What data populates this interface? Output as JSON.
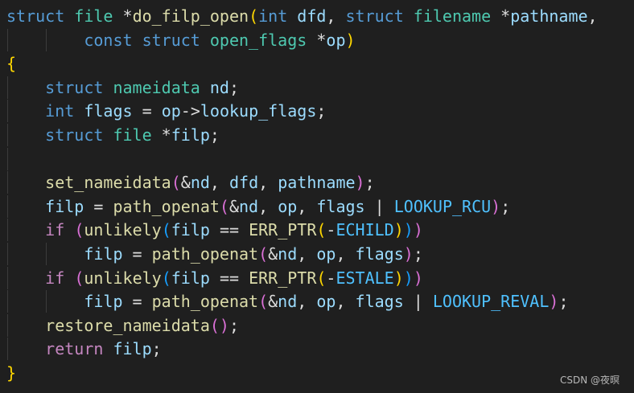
{
  "editor": {
    "colors": {
      "background": "#1f1f1f",
      "keyword": "#569cd6",
      "control_keyword": "#c586c0",
      "type": "#4ec9b0",
      "function": "#dcdcaa",
      "variable": "#9cdcfe",
      "macro": "#4fc1ff",
      "bracket_level1": "#ffd700",
      "bracket_level2": "#da70d6",
      "bracket_level3": "#179fff",
      "plain": "#dcdcdc"
    },
    "lines": [
      [
        {
          "t": "struct",
          "c": "kw"
        },
        {
          "t": " ",
          "c": "pl"
        },
        {
          "t": "file",
          "c": "ty"
        },
        {
          "t": " *",
          "c": "pl"
        },
        {
          "t": "do_filp_open",
          "c": "fn"
        },
        {
          "t": "(",
          "c": "br-y"
        },
        {
          "t": "int",
          "c": "kw"
        },
        {
          "t": " ",
          "c": "pl"
        },
        {
          "t": "dfd",
          "c": "vr"
        },
        {
          "t": ", ",
          "c": "pl"
        },
        {
          "t": "struct",
          "c": "kw"
        },
        {
          "t": " ",
          "c": "pl"
        },
        {
          "t": "filename",
          "c": "ty"
        },
        {
          "t": " *",
          "c": "pl"
        },
        {
          "t": "pathname",
          "c": "vr"
        },
        {
          "t": ",",
          "c": "pl"
        }
      ],
      [
        {
          "t": "        ",
          "c": "pl"
        },
        {
          "t": "const",
          "c": "kw"
        },
        {
          "t": " ",
          "c": "pl"
        },
        {
          "t": "struct",
          "c": "kw"
        },
        {
          "t": " ",
          "c": "pl"
        },
        {
          "t": "open_flags",
          "c": "ty"
        },
        {
          "t": " *",
          "c": "pl"
        },
        {
          "t": "op",
          "c": "vr"
        },
        {
          "t": ")",
          "c": "br-y"
        }
      ],
      [
        {
          "t": "{",
          "c": "br-y"
        }
      ],
      [
        {
          "t": "    ",
          "c": "pl"
        },
        {
          "t": "struct",
          "c": "kw"
        },
        {
          "t": " ",
          "c": "pl"
        },
        {
          "t": "nameidata",
          "c": "ty"
        },
        {
          "t": " ",
          "c": "pl"
        },
        {
          "t": "nd",
          "c": "vr"
        },
        {
          "t": ";",
          "c": "pl"
        }
      ],
      [
        {
          "t": "    ",
          "c": "pl"
        },
        {
          "t": "int",
          "c": "kw"
        },
        {
          "t": " ",
          "c": "pl"
        },
        {
          "t": "flags",
          "c": "vr"
        },
        {
          "t": " = ",
          "c": "pl"
        },
        {
          "t": "op",
          "c": "vr"
        },
        {
          "t": "->",
          "c": "pl"
        },
        {
          "t": "lookup_flags",
          "c": "vr"
        },
        {
          "t": ";",
          "c": "pl"
        }
      ],
      [
        {
          "t": "    ",
          "c": "pl"
        },
        {
          "t": "struct",
          "c": "kw"
        },
        {
          "t": " ",
          "c": "pl"
        },
        {
          "t": "file",
          "c": "ty"
        },
        {
          "t": " *",
          "c": "pl"
        },
        {
          "t": "filp",
          "c": "vr"
        },
        {
          "t": ";",
          "c": "pl"
        }
      ],
      [],
      [
        {
          "t": "    ",
          "c": "pl"
        },
        {
          "t": "set_nameidata",
          "c": "fn"
        },
        {
          "t": "(",
          "c": "br-p"
        },
        {
          "t": "&",
          "c": "pl"
        },
        {
          "t": "nd",
          "c": "vr"
        },
        {
          "t": ", ",
          "c": "pl"
        },
        {
          "t": "dfd",
          "c": "vr"
        },
        {
          "t": ", ",
          "c": "pl"
        },
        {
          "t": "pathname",
          "c": "vr"
        },
        {
          "t": ")",
          "c": "br-p"
        },
        {
          "t": ";",
          "c": "pl"
        }
      ],
      [
        {
          "t": "    ",
          "c": "pl"
        },
        {
          "t": "filp",
          "c": "vr"
        },
        {
          "t": " = ",
          "c": "pl"
        },
        {
          "t": "path_openat",
          "c": "fn"
        },
        {
          "t": "(",
          "c": "br-p"
        },
        {
          "t": "&",
          "c": "pl"
        },
        {
          "t": "nd",
          "c": "vr"
        },
        {
          "t": ", ",
          "c": "pl"
        },
        {
          "t": "op",
          "c": "vr"
        },
        {
          "t": ", ",
          "c": "pl"
        },
        {
          "t": "flags",
          "c": "vr"
        },
        {
          "t": " | ",
          "c": "pl"
        },
        {
          "t": "LOOKUP_RCU",
          "c": "mc"
        },
        {
          "t": ")",
          "c": "br-p"
        },
        {
          "t": ";",
          "c": "pl"
        }
      ],
      [
        {
          "t": "    ",
          "c": "pl"
        },
        {
          "t": "if",
          "c": "kc"
        },
        {
          "t": " ",
          "c": "pl"
        },
        {
          "t": "(",
          "c": "br-p"
        },
        {
          "t": "unlikely",
          "c": "fn"
        },
        {
          "t": "(",
          "c": "br-b"
        },
        {
          "t": "filp",
          "c": "vr"
        },
        {
          "t": " == ",
          "c": "pl"
        },
        {
          "t": "ERR_PTR",
          "c": "fn"
        },
        {
          "t": "(",
          "c": "br-y"
        },
        {
          "t": "-",
          "c": "pl"
        },
        {
          "t": "ECHILD",
          "c": "mc"
        },
        {
          "t": ")",
          "c": "br-y"
        },
        {
          "t": ")",
          "c": "br-b"
        },
        {
          "t": ")",
          "c": "br-p"
        }
      ],
      [
        {
          "t": "        ",
          "c": "pl"
        },
        {
          "t": "filp",
          "c": "vr"
        },
        {
          "t": " = ",
          "c": "pl"
        },
        {
          "t": "path_openat",
          "c": "fn"
        },
        {
          "t": "(",
          "c": "br-p"
        },
        {
          "t": "&",
          "c": "pl"
        },
        {
          "t": "nd",
          "c": "vr"
        },
        {
          "t": ", ",
          "c": "pl"
        },
        {
          "t": "op",
          "c": "vr"
        },
        {
          "t": ", ",
          "c": "pl"
        },
        {
          "t": "flags",
          "c": "vr"
        },
        {
          "t": ")",
          "c": "br-p"
        },
        {
          "t": ";",
          "c": "pl"
        }
      ],
      [
        {
          "t": "    ",
          "c": "pl"
        },
        {
          "t": "if",
          "c": "kc"
        },
        {
          "t": " ",
          "c": "pl"
        },
        {
          "t": "(",
          "c": "br-p"
        },
        {
          "t": "unlikely",
          "c": "fn"
        },
        {
          "t": "(",
          "c": "br-b"
        },
        {
          "t": "filp",
          "c": "vr"
        },
        {
          "t": " == ",
          "c": "pl"
        },
        {
          "t": "ERR_PTR",
          "c": "fn"
        },
        {
          "t": "(",
          "c": "br-y"
        },
        {
          "t": "-",
          "c": "pl"
        },
        {
          "t": "ESTALE",
          "c": "mc"
        },
        {
          "t": ")",
          "c": "br-y"
        },
        {
          "t": ")",
          "c": "br-b"
        },
        {
          "t": ")",
          "c": "br-p"
        }
      ],
      [
        {
          "t": "        ",
          "c": "pl"
        },
        {
          "t": "filp",
          "c": "vr"
        },
        {
          "t": " = ",
          "c": "pl"
        },
        {
          "t": "path_openat",
          "c": "fn"
        },
        {
          "t": "(",
          "c": "br-p"
        },
        {
          "t": "&",
          "c": "pl"
        },
        {
          "t": "nd",
          "c": "vr"
        },
        {
          "t": ", ",
          "c": "pl"
        },
        {
          "t": "op",
          "c": "vr"
        },
        {
          "t": ", ",
          "c": "pl"
        },
        {
          "t": "flags",
          "c": "vr"
        },
        {
          "t": " | ",
          "c": "pl"
        },
        {
          "t": "LOOKUP_REVAL",
          "c": "mc"
        },
        {
          "t": ")",
          "c": "br-p"
        },
        {
          "t": ";",
          "c": "pl"
        }
      ],
      [
        {
          "t": "    ",
          "c": "pl"
        },
        {
          "t": "restore_nameidata",
          "c": "fn"
        },
        {
          "t": "(",
          "c": "br-p"
        },
        {
          "t": ")",
          "c": "br-p"
        },
        {
          "t": ";",
          "c": "pl"
        }
      ],
      [
        {
          "t": "    ",
          "c": "pl"
        },
        {
          "t": "return",
          "c": "kc"
        },
        {
          "t": " ",
          "c": "pl"
        },
        {
          "t": "filp",
          "c": "vr"
        },
        {
          "t": ";",
          "c": "pl"
        }
      ],
      [
        {
          "t": "}",
          "c": "br-y"
        }
      ]
    ]
  },
  "watermark": "CSDN @夜暝"
}
